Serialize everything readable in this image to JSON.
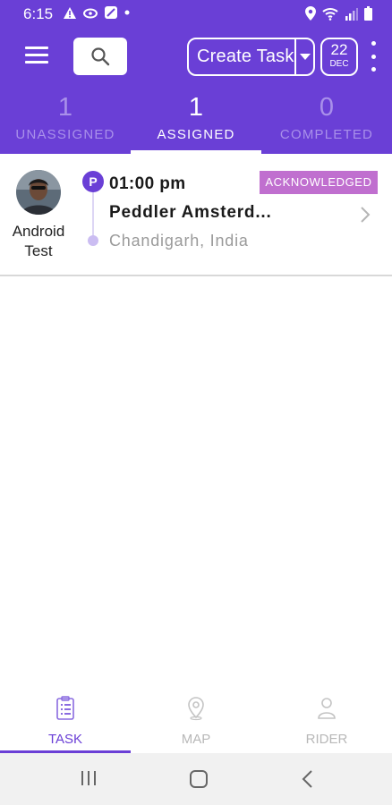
{
  "status_bar": {
    "time": "6:15",
    "left_icons": [
      "warning-icon",
      "cloud-icon",
      "block-icon",
      "dot-icon"
    ],
    "right_icons": [
      "location-icon",
      "wifi-icon",
      "signal-icon",
      "battery-icon"
    ]
  },
  "app_bar": {
    "menu_icon": "menu-icon",
    "search_icon": "search-icon",
    "create_task_label": "Create Task",
    "date_day": "22",
    "date_month": "DEC",
    "more_icon": "more-vert-icon"
  },
  "tabs": [
    {
      "count": "1",
      "label": "UNASSIGNED",
      "active": false
    },
    {
      "count": "1",
      "label": "ASSIGNED",
      "active": true
    },
    {
      "count": "0",
      "label": "COMPLETED",
      "active": false
    }
  ],
  "task": {
    "rider_name_line1": "Android",
    "rider_name_line2": "Test",
    "pickup_marker": "P",
    "time": "01:00 pm",
    "title": "Peddler Amsterd...",
    "location": "Chandigarh, India",
    "status": "ACKNOWLEDGED"
  },
  "bottom_nav": [
    {
      "label": "TASK",
      "icon": "task-icon",
      "active": true
    },
    {
      "label": "MAP",
      "icon": "map-pin-icon",
      "active": false
    },
    {
      "label": "RIDER",
      "icon": "rider-icon",
      "active": false
    }
  ],
  "colors": {
    "primary": "#6a3fd6",
    "tab_inactive": "#a990ea",
    "status_badge": "#c06fcf",
    "nav_inactive": "#b8b8b8"
  }
}
